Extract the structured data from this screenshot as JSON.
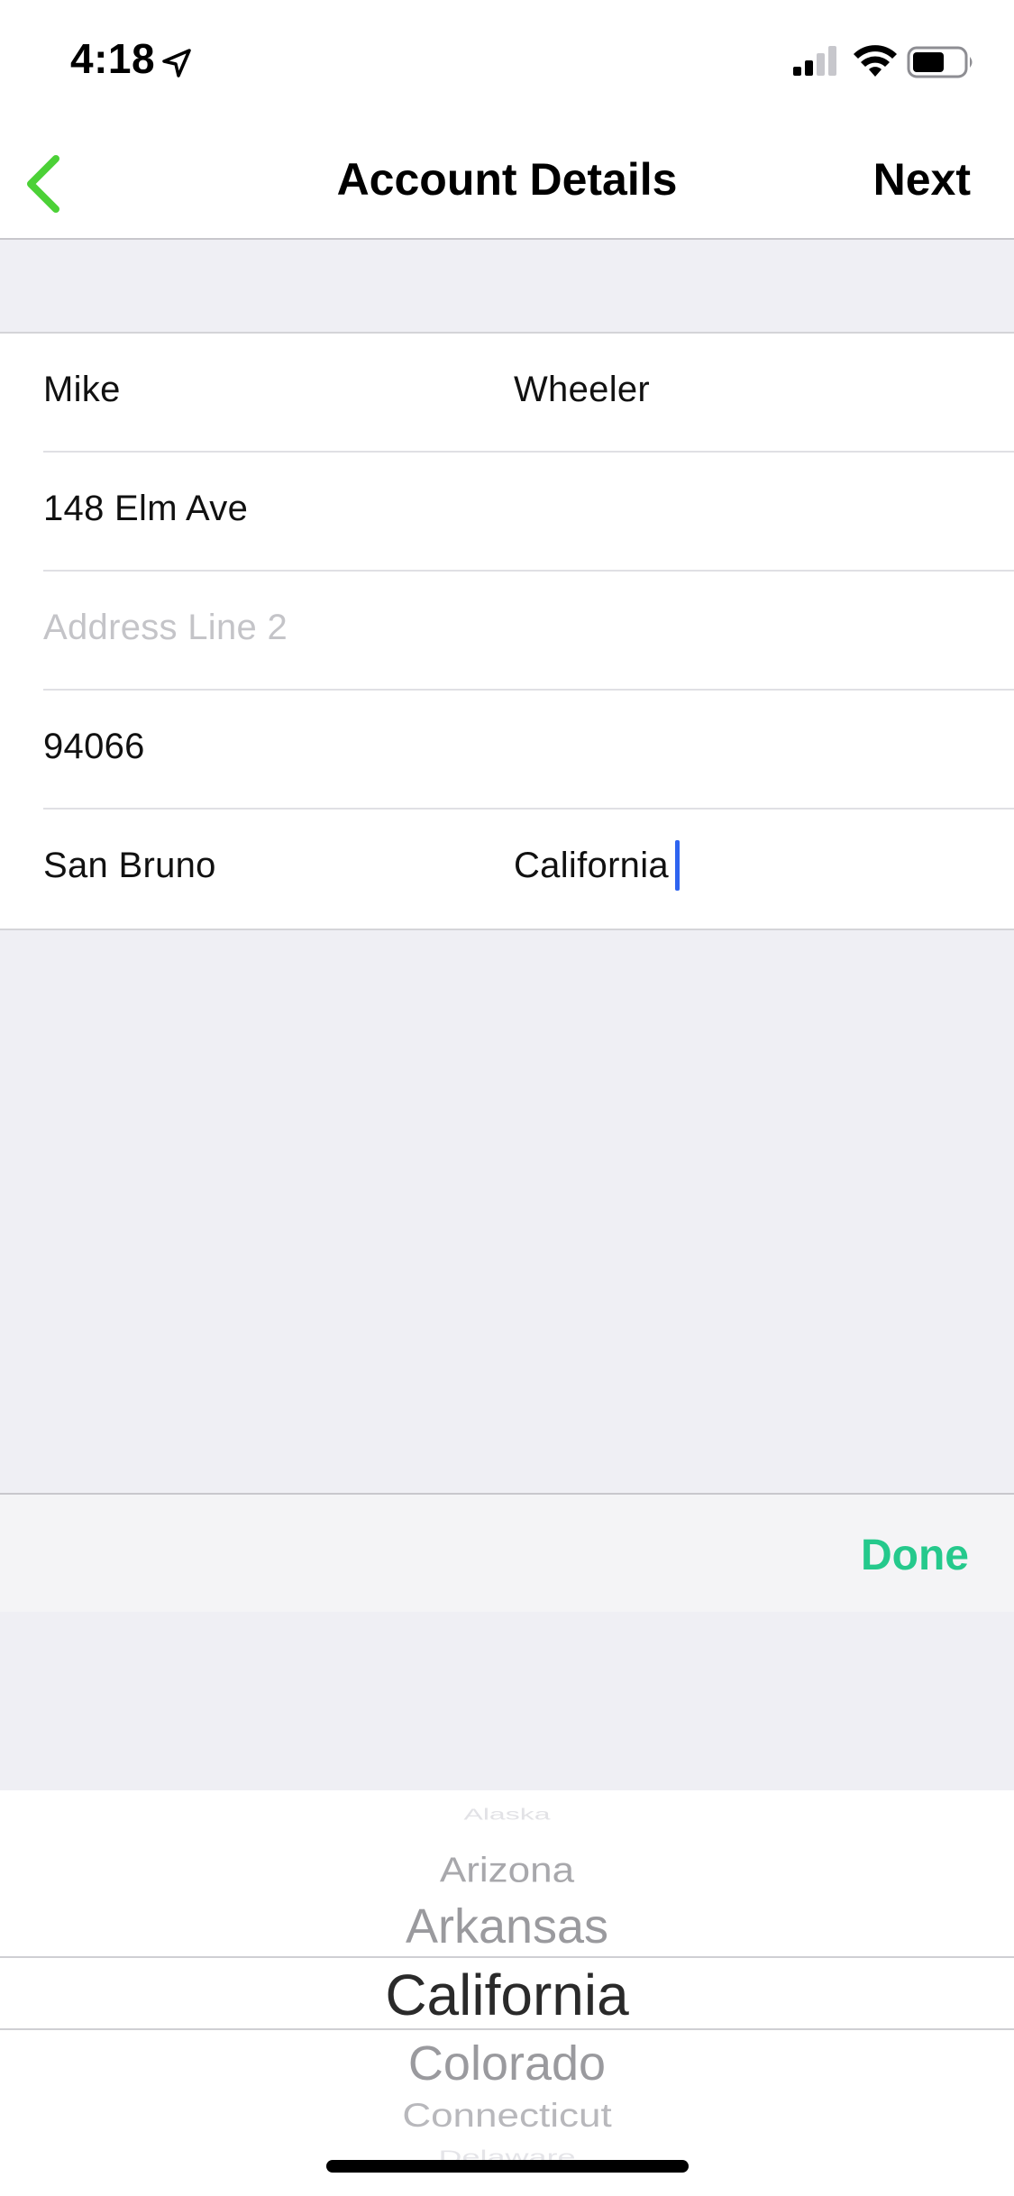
{
  "status_bar": {
    "time": "4:18"
  },
  "nav": {
    "title": "Account Details",
    "next_label": "Next"
  },
  "form": {
    "first_name": "Mike",
    "last_name": "Wheeler",
    "address_line_1": "148 Elm Ave",
    "address_line_2_placeholder": "Address Line 2",
    "zip": "94066",
    "city": "San Bruno",
    "state": "California"
  },
  "toolbar": {
    "done_label": "Done",
    "done_color": "#25c98c"
  },
  "picker": {
    "items": [
      "Alaska",
      "Arizona",
      "Arkansas",
      "California",
      "Colorado",
      "Connecticut",
      "Delaware"
    ],
    "selected": "California"
  },
  "colors": {
    "back_arrow": "#4cd137",
    "caret": "#2e64f0",
    "grouped_background": "#efeff4"
  }
}
